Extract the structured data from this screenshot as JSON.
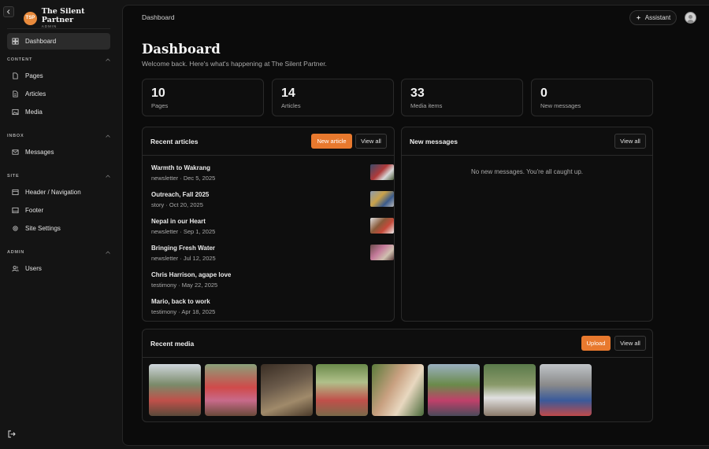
{
  "brand": {
    "logo_text": "TSP",
    "name": "The Silent Partner",
    "role": "ADMIN",
    "accent": "#e88a3c"
  },
  "sidebar": {
    "dashboard": "Dashboard",
    "sections": [
      {
        "label": "CONTENT",
        "items": [
          "Pages",
          "Articles",
          "Media"
        ]
      },
      {
        "label": "INBOX",
        "items": [
          "Messages"
        ]
      },
      {
        "label": "SITE",
        "items": [
          "Header / Navigation",
          "Footer",
          "Site Settings"
        ]
      },
      {
        "label": "ADMIN",
        "items": [
          "Users"
        ]
      }
    ]
  },
  "topbar": {
    "breadcrumb": "Dashboard",
    "assistant_label": "Assistant"
  },
  "page": {
    "title": "Dashboard",
    "subtitle": "Welcome back. Here's what's happening at The Silent Partner."
  },
  "stats": [
    {
      "value": "10",
      "label": "Pages"
    },
    {
      "value": "14",
      "label": "Articles"
    },
    {
      "value": "33",
      "label": "Media items"
    },
    {
      "value": "0",
      "label": "New messages"
    }
  ],
  "recent_articles": {
    "title": "Recent articles",
    "new_label": "New article",
    "view_all_label": "View all",
    "items": [
      {
        "title": "Warmth to Wakrang",
        "meta": "newsletter · Dec 5, 2025",
        "has_thumb": true
      },
      {
        "title": "Outreach, Fall 2025",
        "meta": "story · Oct 20, 2025",
        "has_thumb": true
      },
      {
        "title": "Nepal in our Heart",
        "meta": "newsletter · Sep 1, 2025",
        "has_thumb": true
      },
      {
        "title": "Bringing Fresh Water",
        "meta": "newsletter · Jul 12, 2025",
        "has_thumb": true
      },
      {
        "title": "Chris Harrison, agape love",
        "meta": "testimony · May 22, 2025",
        "has_thumb": false
      },
      {
        "title": "Mario, back to work",
        "meta": "testimony · Apr 18, 2025",
        "has_thumb": false
      }
    ]
  },
  "new_messages": {
    "title": "New messages",
    "view_all_label": "View all",
    "empty_text": "No new messages. You're all caught up."
  },
  "recent_media": {
    "title": "Recent media",
    "upload_label": "Upload",
    "view_all_label": "View all",
    "item_count": 8
  },
  "colors": {
    "accent": "#e8792e",
    "background": "#141414",
    "panel": "#0b0b0b"
  }
}
